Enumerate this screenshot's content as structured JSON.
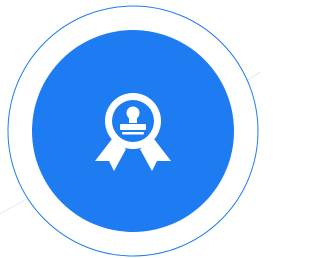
{
  "badge": {
    "icon": "award-ribbon-icon",
    "colors": {
      "background": "#ffffff",
      "ring": "#1e7cf2",
      "disc": "#1e7cf2",
      "icon": "#ffffff",
      "decor_line": "#e6e8ee"
    }
  }
}
